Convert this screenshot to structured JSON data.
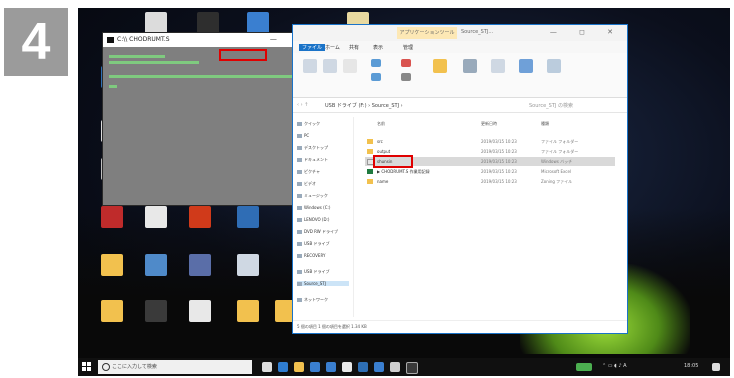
{
  "step": {
    "number": "4"
  },
  "desktop": {
    "icons": [
      {
        "name": "desktop-icon-1",
        "label": "",
        "color": "#2e6fb5"
      },
      {
        "name": "desktop-icon-2",
        "label": "",
        "color": "#ffffff"
      },
      {
        "name": "desktop-icon-3",
        "label": "",
        "color": "#bf2b2b"
      },
      {
        "name": "desktop-icon-4",
        "label": "",
        "color": "#f2c14e"
      }
    ]
  },
  "cmd_window": {
    "title": "C:\\\\ CHODRUMT.S",
    "controls": "— ◻ ✕"
  },
  "explorer": {
    "context_tab": "アプリケーションツール",
    "title": "Source_STJ...",
    "controls": "— ◻ ✕",
    "tabs": [
      "ファイル",
      "ホーム",
      "共有",
      "表示",
      "管理"
    ],
    "address": "USB ドライブ (F:) › Source_STJ ›",
    "search": "Source_STJ の検索",
    "columns": {
      "name": "名前",
      "date": "更新日時",
      "type": "種類"
    },
    "rows": [
      {
        "name": "src",
        "date": "2019/03/15 10:23",
        "type": "ファイル フォルダー"
      },
      {
        "name": "output",
        "date": "2019/03/15 10:23",
        "type": "ファイル フォルダー"
      },
      {
        "name": "shunsin",
        "date": "2019/03/15 10:23",
        "type": "Windows バッチ"
      },
      {
        "name": "▶ CHODRUMT.S 作業用記録",
        "date": "2019/03/15 10:23",
        "type": "Microsoft Excel"
      },
      {
        "name": "name",
        "date": "2019/03/15 10:23",
        "type": "Zoning ファイル"
      }
    ],
    "nav": [
      "クイック",
      "PC",
      "デスクトップ",
      "ドキュメント",
      "ピクチャ",
      "ビデオ",
      "ミュージック",
      "Windows (C:)",
      "LENOVO (D:)",
      "DVD RW ドライブ",
      "USB ドライブ",
      "RECOVERY",
      "USB ドライブ",
      "Source_STJ",
      "ネットワーク"
    ],
    "status": "5 個の項目   1 個の項目を選択 1.34 KB"
  },
  "taskbar": {
    "search_placeholder": "ここに入力して検索",
    "clock": "18:05"
  },
  "colors": {
    "highlight": "#e00000",
    "cmd_bg": "#7f7f7f",
    "cmd_text": "#7fd37f"
  }
}
